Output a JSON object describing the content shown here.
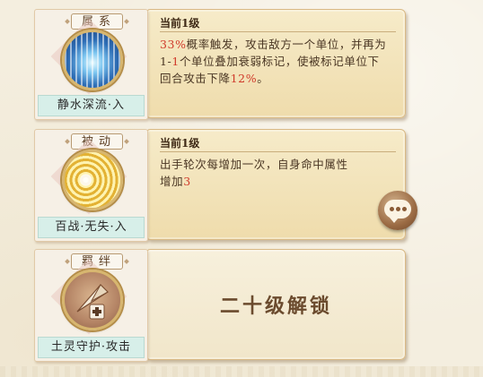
{
  "skills": [
    {
      "category": "属系",
      "name": "静水深流·入",
      "level": "当前1级",
      "desc": [
        "33%",
        "概率触发，攻击敌方一个单位，并再为1-",
        "1",
        "个单位叠加衰弱标记，使被标记单位下回合攻击下降",
        "12%",
        "。"
      ]
    },
    {
      "category": "被动",
      "name": "百战·无失·入",
      "level": "当前1级",
      "desc": [
        "出手轮次每增加一次，自身命中属性增加",
        "3"
      ]
    },
    {
      "category": "羁绊",
      "name": "土灵守护·攻击",
      "locked_text": "二十级解锁"
    }
  ],
  "colors": {
    "highlight": "#d03a2b",
    "text": "#4a3623",
    "name_bg": "#d7efe9"
  },
  "icons": {
    "chat": "chat-bubble-icon",
    "water": "water-crest-icon",
    "gold": "target-crest-icon",
    "earth": "kite-plus-icon"
  }
}
